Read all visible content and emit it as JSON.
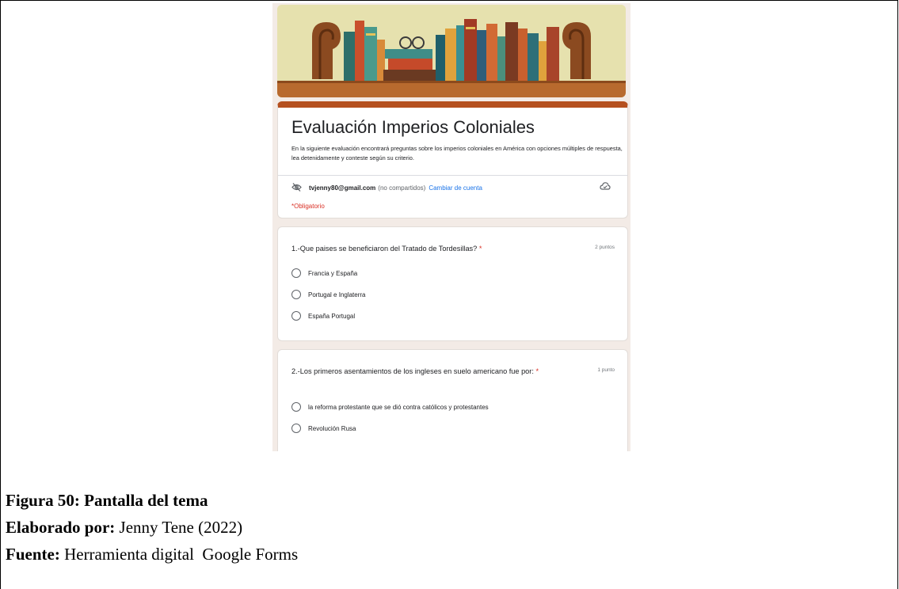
{
  "form": {
    "title": "Evaluación Imperios Coloniales",
    "description": "En la siguiente evaluación encontrará preguntas sobre los imperios coloniales en América con opciones múltiples de respuesta, lea detenidamente y conteste según su criterio.",
    "account": {
      "email": "tvjenny80@gmail.com",
      "not_shared": "(no compartidos)",
      "switch_label": "Cambiar de cuenta"
    },
    "required_note": "*Obligatorio",
    "questions": [
      {
        "text": "1.-Que paises se beneficiaron del Tratado de Tordesillas?",
        "required_mark": "*",
        "points": "2 puntos",
        "options": [
          "Francia y España",
          "Portugal e Inglaterra",
          "España Portugal"
        ]
      },
      {
        "text": "2.-Los primeros asentamientos de los ingleses en suelo americano fue por:",
        "required_mark": "*",
        "points": "1 punto",
        "options": [
          "la reforma protestante que se dió contra católicos y protestantes",
          "Revolución Rusa"
        ]
      }
    ]
  },
  "caption": {
    "figure": "Figura 50: Pantalla del tema",
    "author_label": "Elaborado por:",
    "author_value": "Jenny Tene (2022)",
    "source_label": "Fuente:",
    "source_value": "Herramienta digital  Google Forms"
  },
  "colors": {
    "accent": "#b5501f",
    "link": "#1a73e8",
    "required": "#d93025",
    "background": "#f3ebe6"
  }
}
